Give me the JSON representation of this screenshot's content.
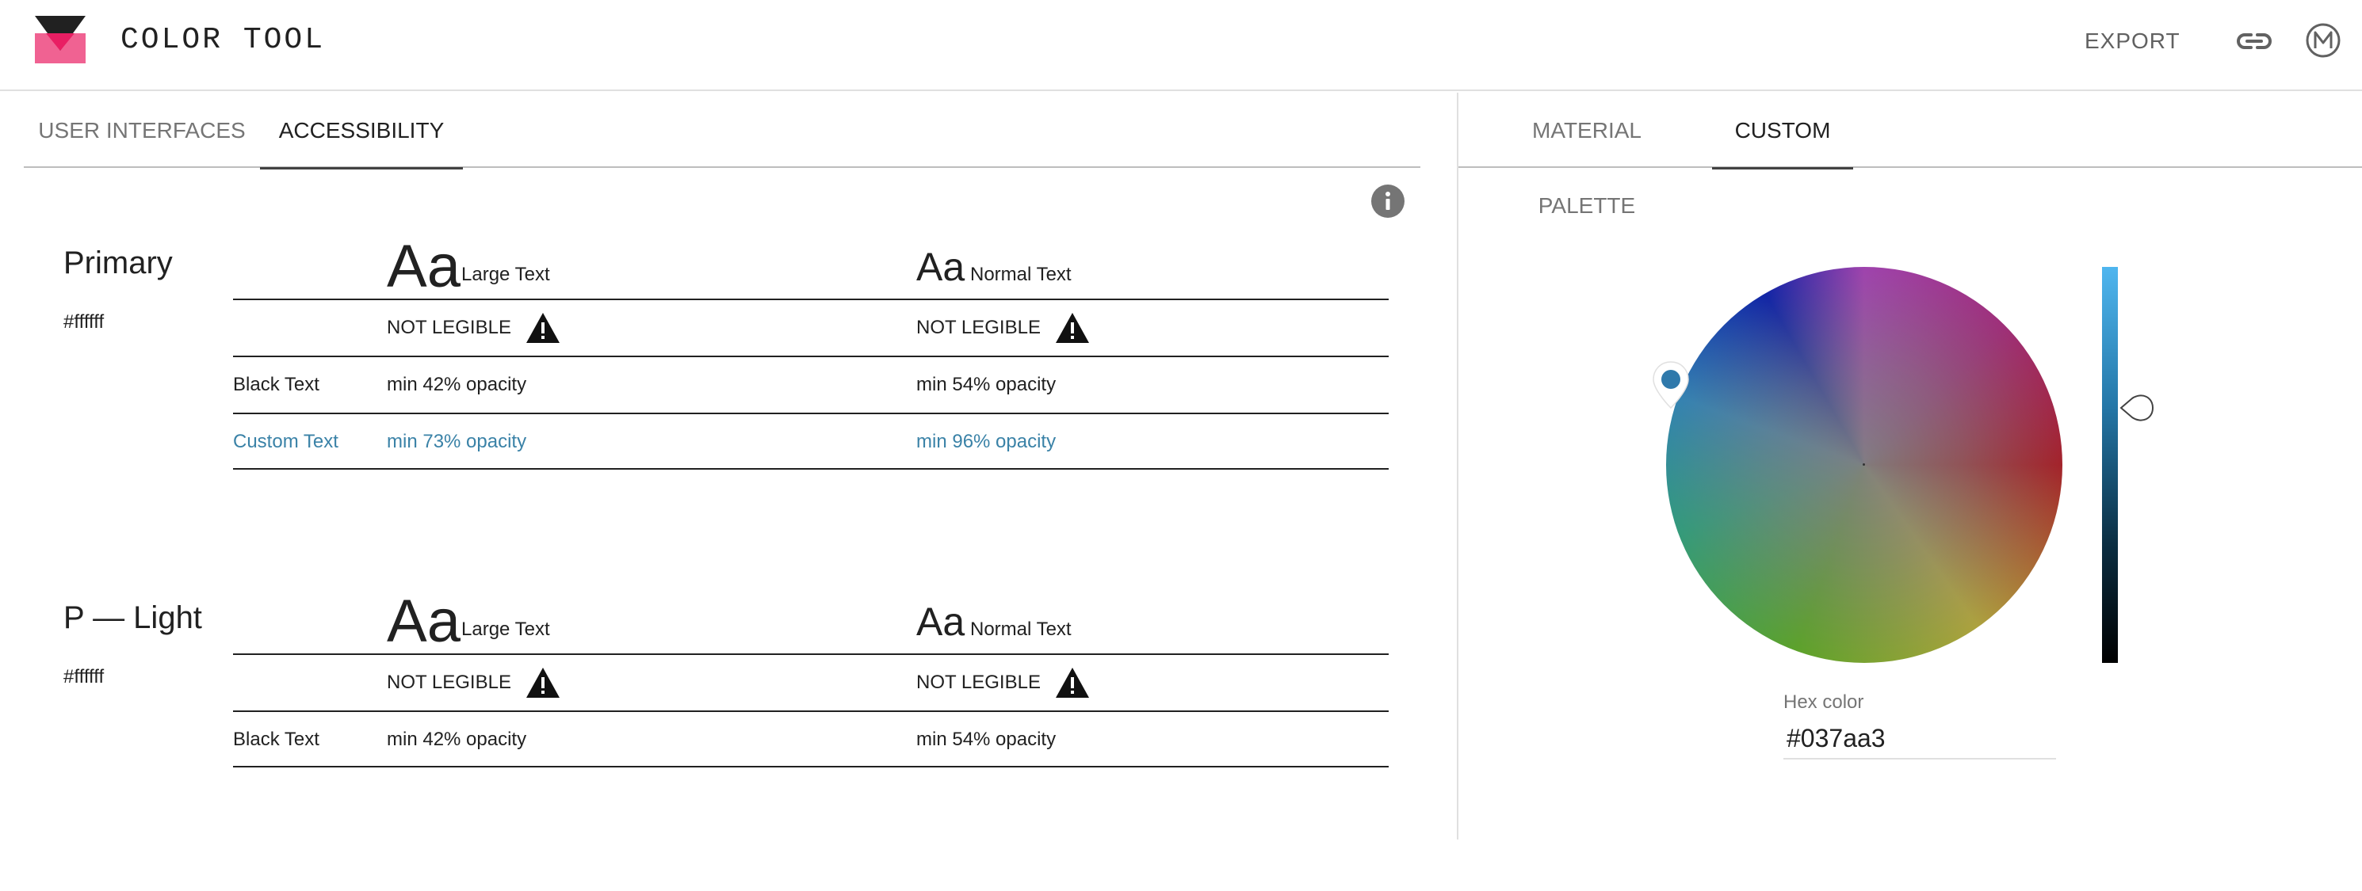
{
  "app": {
    "title": "COLOR TOOL",
    "export_label": "EXPORT",
    "logo_icon": "color-tool-logo",
    "link_icon": "link-icon",
    "account_icon": "material-m-icon"
  },
  "left_tabs": [
    {
      "label": "USER INTERFACES",
      "active": false
    },
    {
      "label": "ACCESSIBILITY",
      "active": true
    }
  ],
  "right_tabs": [
    {
      "label": "MATERIAL PALETTE",
      "active": false
    },
    {
      "label": "CUSTOM",
      "active": true
    }
  ],
  "sections": [
    {
      "name": "Primary",
      "hex": "#ffffff",
      "large_sample": "Aa",
      "large_label": "Large Text",
      "normal_sample": "Aa",
      "normal_label": "Normal Text",
      "status_large": "NOT LEGIBLE",
      "status_normal": "NOT LEGIBLE",
      "black_label": "Black Text",
      "black_large": "min 42% opacity",
      "black_normal": "min 54% opacity",
      "custom_label": "Custom Text",
      "custom_large": "min 73% opacity",
      "custom_normal": "min 96% opacity"
    },
    {
      "name": "P — Light",
      "hex": "#ffffff",
      "large_sample": "Aa",
      "large_label": "Large Text",
      "normal_sample": "Aa",
      "normal_label": "Normal Text",
      "status_large": "NOT LEGIBLE",
      "status_normal": "NOT LEGIBLE",
      "black_label": "Black Text",
      "black_large": "min 42% opacity",
      "black_normal": "min 54% opacity"
    }
  ],
  "picker": {
    "hex_label": "Hex color",
    "hex_value": "#037aa3",
    "selected_color": "#037aa3",
    "custom_text_color": "#3a82a7"
  },
  "icons": {
    "info": "info-icon",
    "warning": "warning-triangle-icon"
  }
}
